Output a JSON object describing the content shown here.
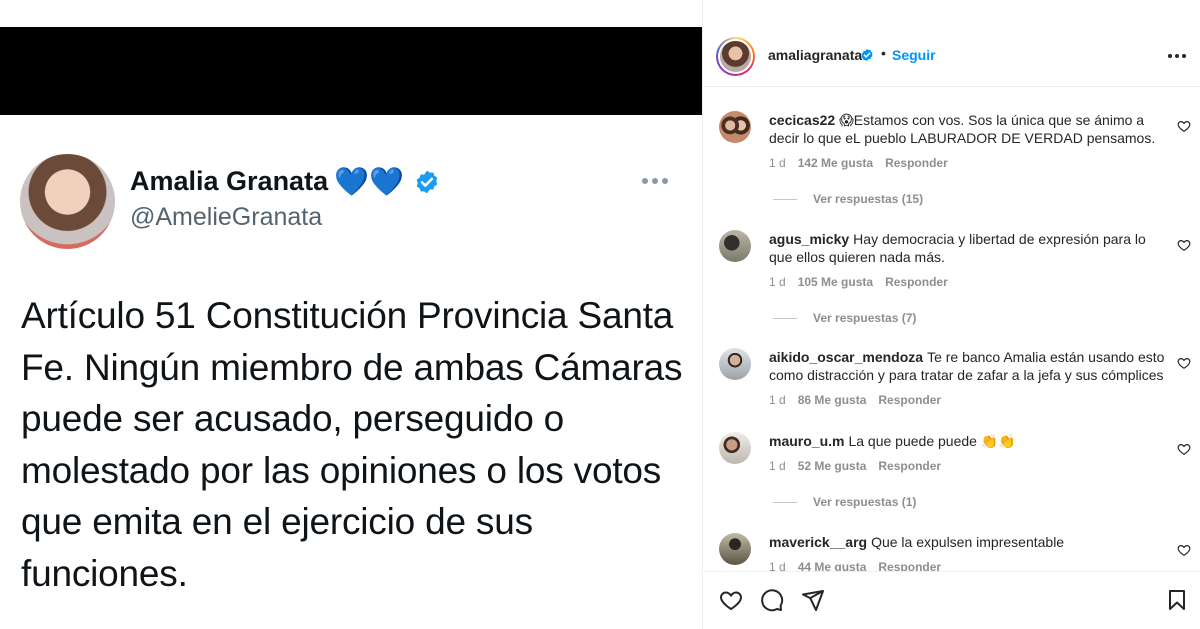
{
  "tweet": {
    "name": "Amalia Granata",
    "hearts": "💙💙",
    "handle": "@AmelieGranata",
    "text": "Artículo 51 Constitución Provincia Santa Fe. Ningún miembro de ambas Cámaras puede ser acusado, perseguido o molestado por las opiniones o los votos que emita en el ejercicio de sus funciones."
  },
  "post_header": {
    "username": "amaliagranata",
    "separator": "•",
    "follow_label": "Seguir"
  },
  "comments": [
    {
      "username": "cecicas22",
      "emoji": "😱",
      "text": "Estamos con vos. Sos la única que se ánimo a decir lo que eL pueblo LABURADOR DE VERDAD pensamos.",
      "time": "1 d",
      "likes": "142 Me gusta",
      "reply": "Responder",
      "view_replies": "Ver respuestas (15)"
    },
    {
      "username": "agus_micky",
      "emoji": "",
      "text": "Hay democracia y libertad de expresión para lo que ellos quieren nada más.",
      "time": "1 d",
      "likes": "105 Me gusta",
      "reply": "Responder",
      "view_replies": "Ver respuestas (7)"
    },
    {
      "username": "aikido_oscar_mendoza",
      "emoji": "",
      "text": "Te re banco Amalia están usando esto como distracción y para tratar de zafar a la jefa y sus cómplices",
      "time": "1 d",
      "likes": "86 Me gusta",
      "reply": "Responder",
      "view_replies": ""
    },
    {
      "username": "mauro_u.m",
      "emoji": "",
      "text": "La que puede puede 👏👏",
      "time": "1 d",
      "likes": "52 Me gusta",
      "reply": "Responder",
      "view_replies": "Ver respuestas (1)"
    },
    {
      "username": "maverick__arg",
      "emoji": "",
      "text": "Que la expulsen impresentable",
      "time": "1 d",
      "likes": "44 Me gusta",
      "reply": "Responder",
      "view_replies": ""
    }
  ],
  "icons": {
    "like": "heart-icon",
    "comment": "comment-icon",
    "share": "share-icon",
    "save": "bookmark-icon",
    "verified": "verified-badge-icon",
    "more": "more-options-icon"
  },
  "colors": {
    "follow": "#0095f6",
    "verified": "#1d9bf0",
    "text": "#262626",
    "muted": "#8e8e8e"
  }
}
